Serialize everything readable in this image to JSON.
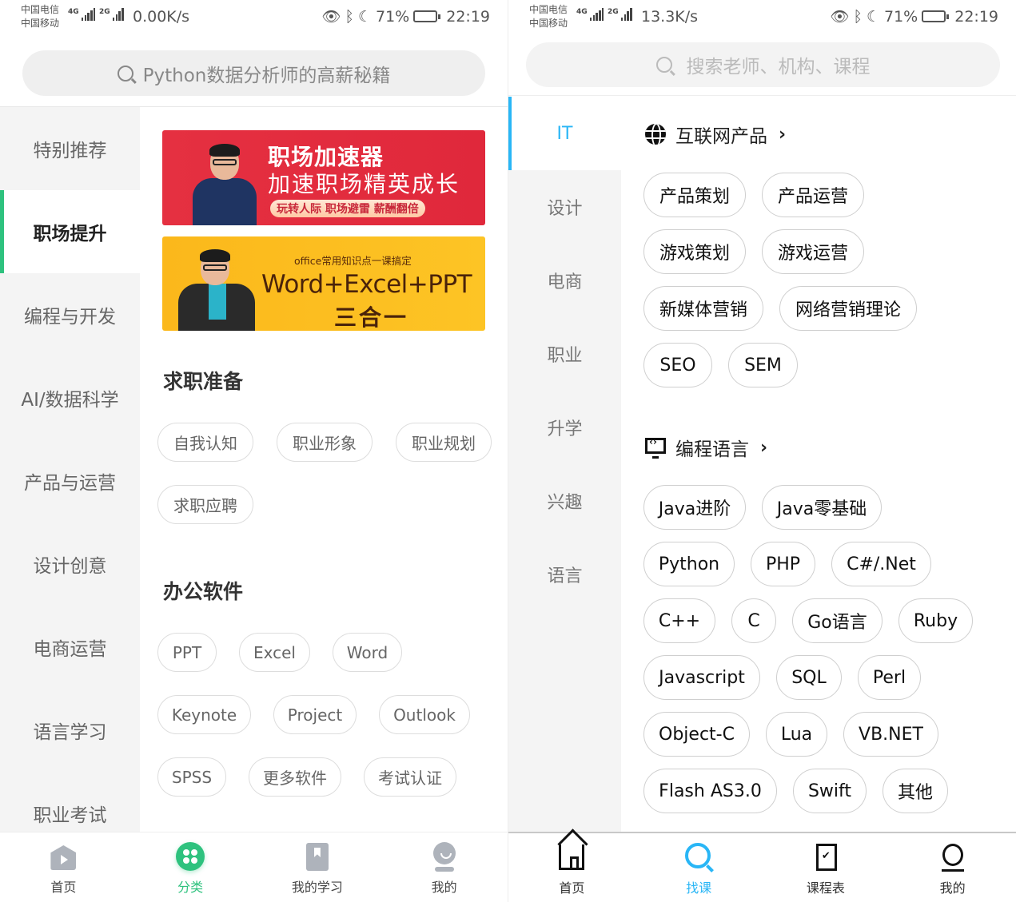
{
  "left": {
    "status": {
      "carrier1": "中国电信",
      "carrier2": "中国移动",
      "net1": "4G",
      "net2": "2G",
      "speed": "0.00K/s",
      "battery_pct": "71%",
      "battery_level": 0.71,
      "time": "22:19"
    },
    "search": {
      "placeholder": "Python数据分析师的高薪秘籍"
    },
    "sidebar": {
      "items": [
        {
          "label": "特别推荐"
        },
        {
          "label": "职场提升",
          "active": true
        },
        {
          "label": "编程与开发"
        },
        {
          "label": "AI/数据科学"
        },
        {
          "label": "产品与运营"
        },
        {
          "label": "设计创意"
        },
        {
          "label": "电商运营"
        },
        {
          "label": "语言学习"
        },
        {
          "label": "职业考试"
        }
      ]
    },
    "banners": [
      {
        "title": "职场加速器",
        "subtitle": "加速职场精英成长",
        "pill": "玩转人际 职场避雷 薪酬翻倍",
        "color": "#e3293c"
      },
      {
        "top": "office常用知识点一课搞定",
        "main": "Word+Excel+PPT",
        "sub": "三合一",
        "color": "#fdbd20"
      }
    ],
    "sections": [
      {
        "title": "求职准备",
        "tags": [
          "自我认知",
          "职业形象",
          "职业规划",
          "求职应聘"
        ]
      },
      {
        "title": "办公软件",
        "tags": [
          "PPT",
          "Excel",
          "Word",
          "Keynote",
          "Project",
          "Outlook",
          "SPSS",
          "更多软件",
          "考试认证"
        ]
      }
    ],
    "bottom_nav": [
      {
        "label": "首页",
        "icon": "home-play-icon"
      },
      {
        "label": "分类",
        "icon": "category-icon",
        "active": true
      },
      {
        "label": "我的学习",
        "icon": "bookmark-icon"
      },
      {
        "label": "我的",
        "icon": "profile-icon"
      }
    ],
    "accent": "#2ec27e"
  },
  "right": {
    "status": {
      "carrier1": "中国电信",
      "carrier2": "中国移动",
      "net1": "4G",
      "net2": "2G",
      "speed": "13.3K/s",
      "battery_pct": "71%",
      "battery_level": 0.71,
      "time": "22:19"
    },
    "search": {
      "placeholder": "搜索老师、机构、课程"
    },
    "sidebar": {
      "items": [
        {
          "label": "IT",
          "active": true
        },
        {
          "label": "设计"
        },
        {
          "label": "电商"
        },
        {
          "label": "职业"
        },
        {
          "label": "升学"
        },
        {
          "label": "兴趣"
        },
        {
          "label": "语言"
        }
      ]
    },
    "sections": [
      {
        "title": "互联网产品",
        "icon": "globe-icon",
        "tags": [
          "产品策划",
          "产品运营",
          "游戏策划",
          "游戏运营",
          "新媒体营销",
          "网络营销理论",
          "SEO",
          "SEM"
        ]
      },
      {
        "title": "编程语言",
        "icon": "code-monitor-icon",
        "tags": [
          "Java进阶",
          "Java零基础",
          "Python",
          "PHP",
          "C#/.Net",
          "C++",
          "C",
          "Go语言",
          "Ruby",
          "Javascript",
          "SQL",
          "Perl",
          "Object-C",
          "Lua",
          "VB.NET",
          "Flash AS3.0",
          "Swift",
          "其他"
        ]
      }
    ],
    "chevron": "›",
    "bottom_nav": [
      {
        "label": "首页",
        "icon": "home-icon"
      },
      {
        "label": "找课",
        "icon": "search-icon",
        "active": true
      },
      {
        "label": "课程表",
        "icon": "schedule-icon"
      },
      {
        "label": "我的",
        "icon": "profile-icon"
      }
    ],
    "accent": "#29b6f6"
  }
}
